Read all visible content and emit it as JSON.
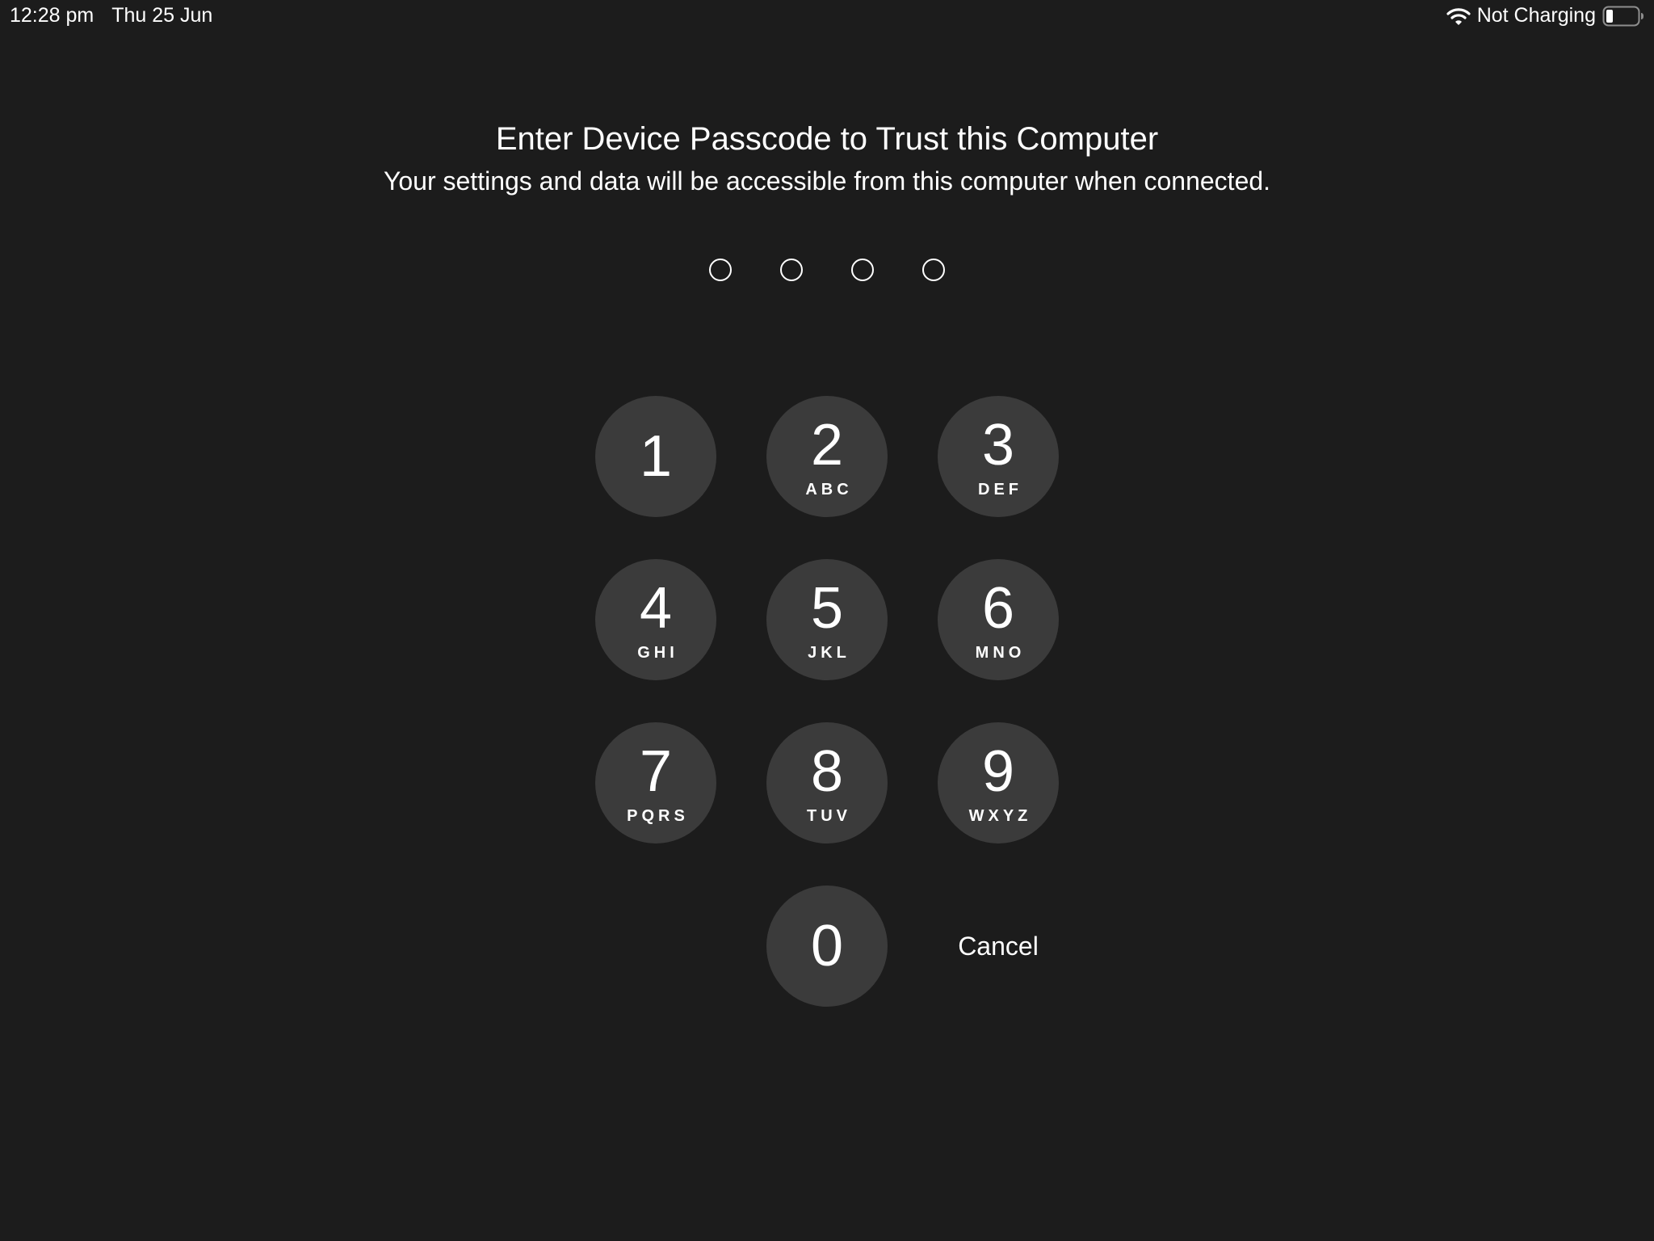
{
  "status_bar": {
    "time": "12:28 pm",
    "date": "Thu 25 Jun",
    "charging_status": "Not Charging",
    "wifi_icon": "wifi-icon",
    "battery_icon": "battery-icon"
  },
  "header": {
    "title": "Enter Device Passcode to Trust this Computer",
    "subtitle": "Your settings and data will be accessible from this computer when connected."
  },
  "passcode": {
    "length": 4,
    "entered": 0
  },
  "keypad": {
    "keys": [
      {
        "digit": "1",
        "letters": ""
      },
      {
        "digit": "2",
        "letters": "ABC"
      },
      {
        "digit": "3",
        "letters": "DEF"
      },
      {
        "digit": "4",
        "letters": "GHI"
      },
      {
        "digit": "5",
        "letters": "JKL"
      },
      {
        "digit": "6",
        "letters": "MNO"
      },
      {
        "digit": "7",
        "letters": "PQRS"
      },
      {
        "digit": "8",
        "letters": "TUV"
      },
      {
        "digit": "9",
        "letters": "WXYZ"
      },
      {
        "digit": "0",
        "letters": ""
      }
    ],
    "cancel_label": "Cancel"
  },
  "colors": {
    "background": "#1c1c1c",
    "key_background": "#3b3b3b",
    "text": "#ffffff"
  }
}
